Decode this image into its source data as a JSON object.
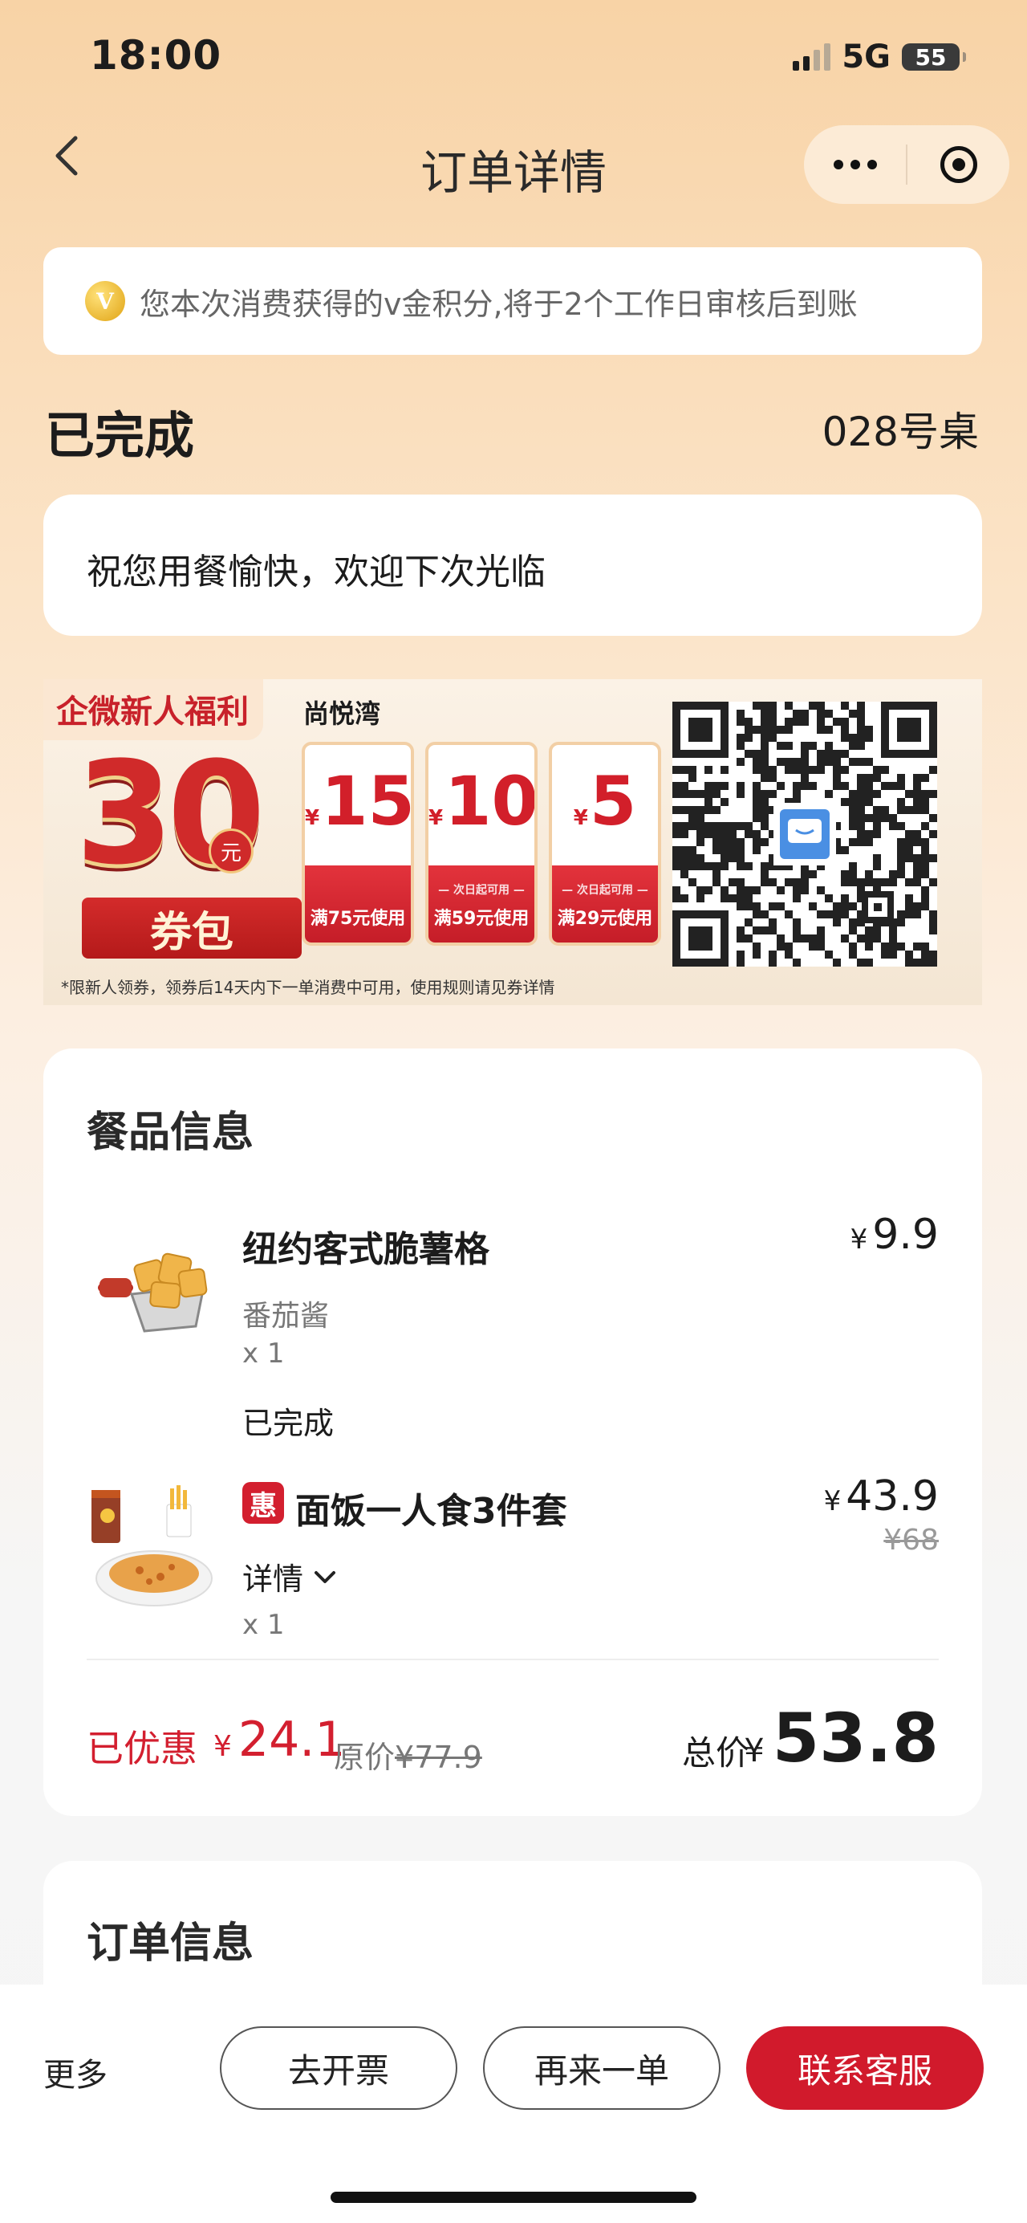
{
  "status_bar": {
    "time": "18:00",
    "network": "5G",
    "battery": "55"
  },
  "nav": {
    "title": "订单详情"
  },
  "notice": {
    "coin_letter": "V",
    "text": "您本次消费获得的v金积分,将于2个工作日审核后到账"
  },
  "order": {
    "status": "已完成",
    "table": "028号桌",
    "greeting": "祝您用餐愉快，欢迎下次光临"
  },
  "banner": {
    "tag": "企微新人福利",
    "brand": "尚悦湾",
    "big_number": "30",
    "yuan": "元",
    "pack_label": "券包",
    "currency": "¥",
    "coupons": [
      {
        "amount": "15",
        "note": "",
        "condition": "满75元使用"
      },
      {
        "amount": "10",
        "note": "— 次日起可用 —",
        "condition": "满59元使用"
      },
      {
        "amount": "5",
        "note": "— 次日起可用 —",
        "condition": "满29元使用"
      }
    ],
    "footnote": "*限新人领券，领券后14天内下一单消费中可用，使用规则请见券详情"
  },
  "items_section": {
    "title": "餐品信息",
    "items": [
      {
        "name": "纽约客式脆薯格",
        "currency": "¥",
        "price": "9.9",
        "option": "番茄酱",
        "qty": "x 1",
        "status": "已完成"
      },
      {
        "badge": "惠",
        "name": "面饭一人食3件套",
        "currency": "¥",
        "price": "43.9",
        "original_price": "¥68",
        "details_label": "详情",
        "qty": "x 1"
      }
    ],
    "summary": {
      "discount_label": "已优惠",
      "currency": "¥",
      "discount_value": "24.1",
      "original_label": "原价",
      "original_value": "¥77.9",
      "total_label": "总价",
      "total_value": "53.8"
    }
  },
  "order_section": {
    "title": "订单信息"
  },
  "bottom_bar": {
    "more": "更多",
    "invoice": "去开票",
    "reorder": "再来一单",
    "contact": "联系客服"
  },
  "colors": {
    "accent_red": "#d11a2c",
    "header_gradient_top": "#f8d3a6"
  }
}
